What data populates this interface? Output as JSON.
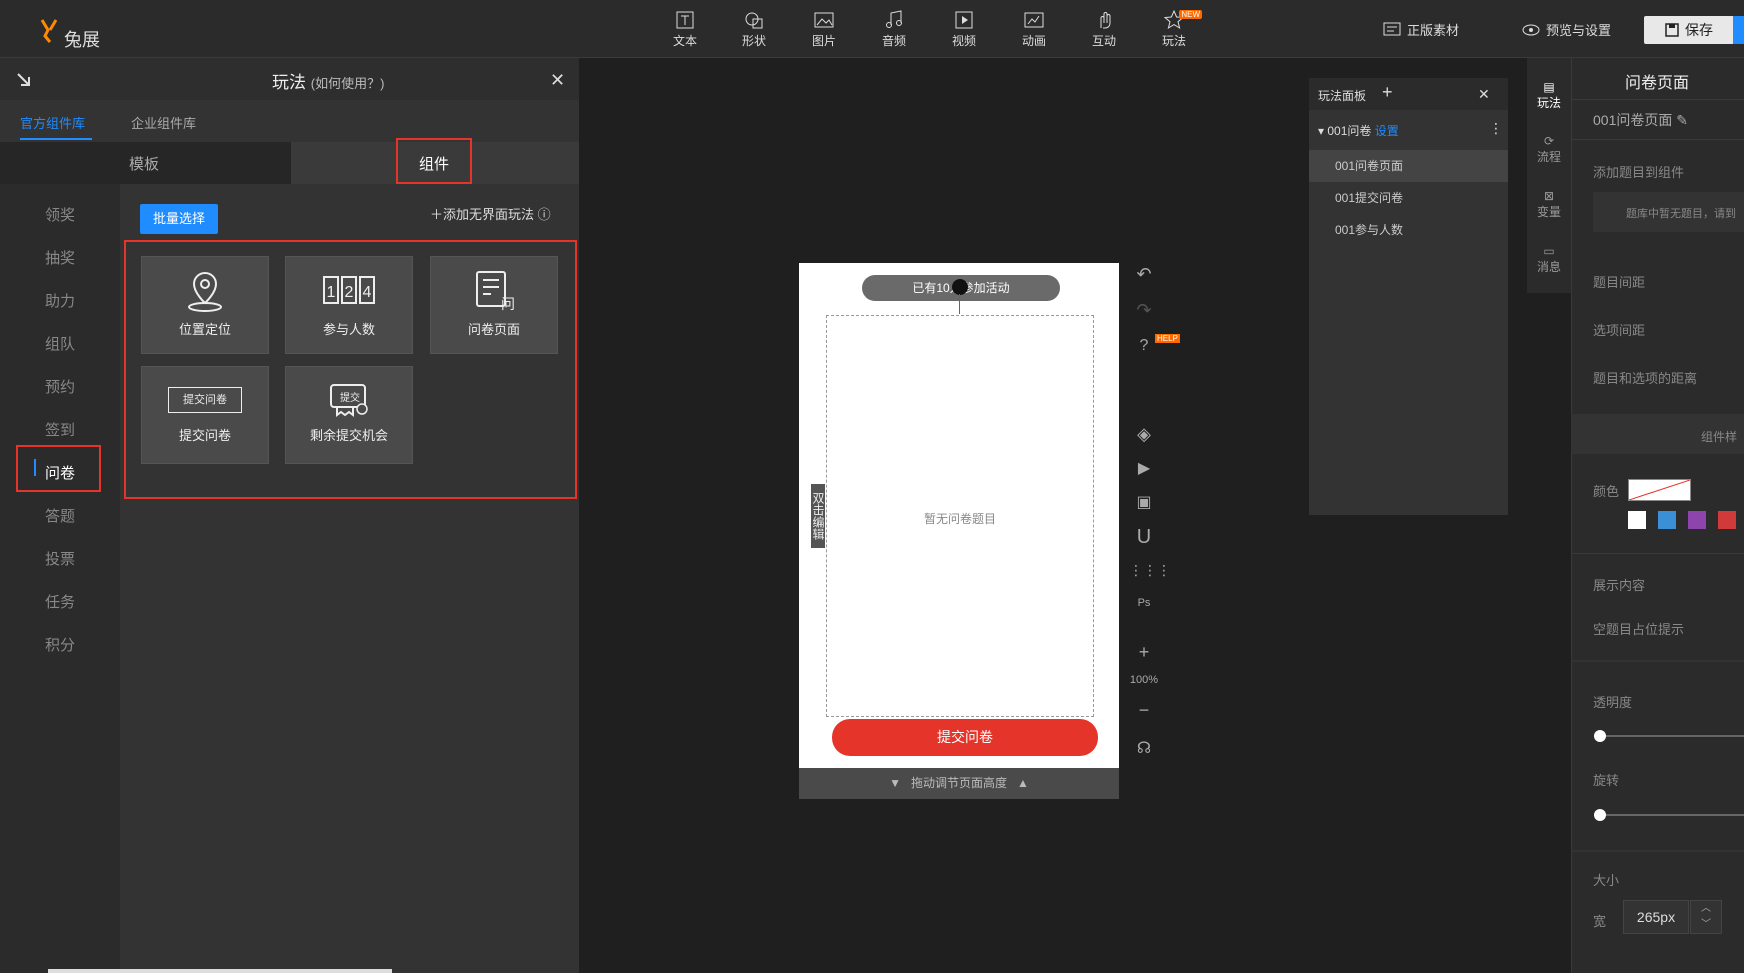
{
  "app": {
    "logo_text": "兔展"
  },
  "toolbar": {
    "tools": [
      {
        "label": "文本",
        "icon": "text-icon"
      },
      {
        "label": "形状",
        "icon": "shape-icon"
      },
      {
        "label": "图片",
        "icon": "image-icon"
      },
      {
        "label": "音频",
        "icon": "music-icon"
      },
      {
        "label": "视频",
        "icon": "video-icon"
      },
      {
        "label": "动画",
        "icon": "animation-icon"
      },
      {
        "label": "互动",
        "icon": "hand-icon"
      },
      {
        "label": "玩法",
        "icon": "star-icon",
        "badge": "NEW"
      }
    ],
    "licensed_material": "正版素材",
    "preview_settings": "预览与设置",
    "save": "保存"
  },
  "left_panel": {
    "title": "玩法",
    "help_link": "(如何使用？)",
    "lib_tabs": [
      "官方组件库",
      "企业组件库"
    ],
    "type_tabs": [
      "模板",
      "组件"
    ],
    "categories": [
      "领奖",
      "抽奖",
      "助力",
      "组队",
      "预约",
      "签到",
      "问卷",
      "答题",
      "投票",
      "任务",
      "积分"
    ],
    "active_category": "问卷",
    "batch_select": "批量选择",
    "add_borderless": "添加无界面玩法",
    "components": [
      {
        "label": "位置定位",
        "icon": "location-pin-icon"
      },
      {
        "label": "参与人数",
        "icon": "counter-icon"
      },
      {
        "label": "问卷页面",
        "icon": "questionnaire-icon"
      },
      {
        "label": "提交问卷",
        "icon": "submit-box-icon",
        "inner": "提交问卷"
      },
      {
        "label": "剩余提交机会",
        "icon": "ticket-machine-icon",
        "inner": "提交"
      }
    ]
  },
  "canvas": {
    "participants_pill": "已有10人参加活动",
    "empty_text": "暂无问卷题目",
    "double_click_edit": "双击编辑",
    "submit_button": "提交问卷",
    "drag_hint": "拖动调节页面高度",
    "help_badge": "HELP",
    "zoom": "100%"
  },
  "play_panel": {
    "title": "玩法面板",
    "group": "001问卷",
    "group_settings": "设置",
    "items": [
      "001问卷页面",
      "001提交问卷",
      "001参与人数"
    ]
  },
  "right_nav": [
    "玩法",
    "流程",
    "变量",
    "消息"
  ],
  "right_panel": {
    "title": "问卷页面",
    "page_name": "001问卷页面",
    "add_question": "添加题目到组件",
    "no_question_hint": "题库中暂无题目，请到",
    "question_spacing": "题目间距",
    "option_spacing": "选项间距",
    "q_option_distance": "题目和选项的距离",
    "component_style": "组件样",
    "color": "颜色",
    "swatches": [
      "#ffffff",
      "#3a8fd6",
      "#8e44ad",
      "#d03a3a"
    ],
    "display_content": "展示内容",
    "empty_placeholder": "空题目占位提示",
    "opacity": "透明度",
    "rotation": "旋转",
    "size": "大小",
    "width_label": "宽",
    "width_value": "265px"
  }
}
